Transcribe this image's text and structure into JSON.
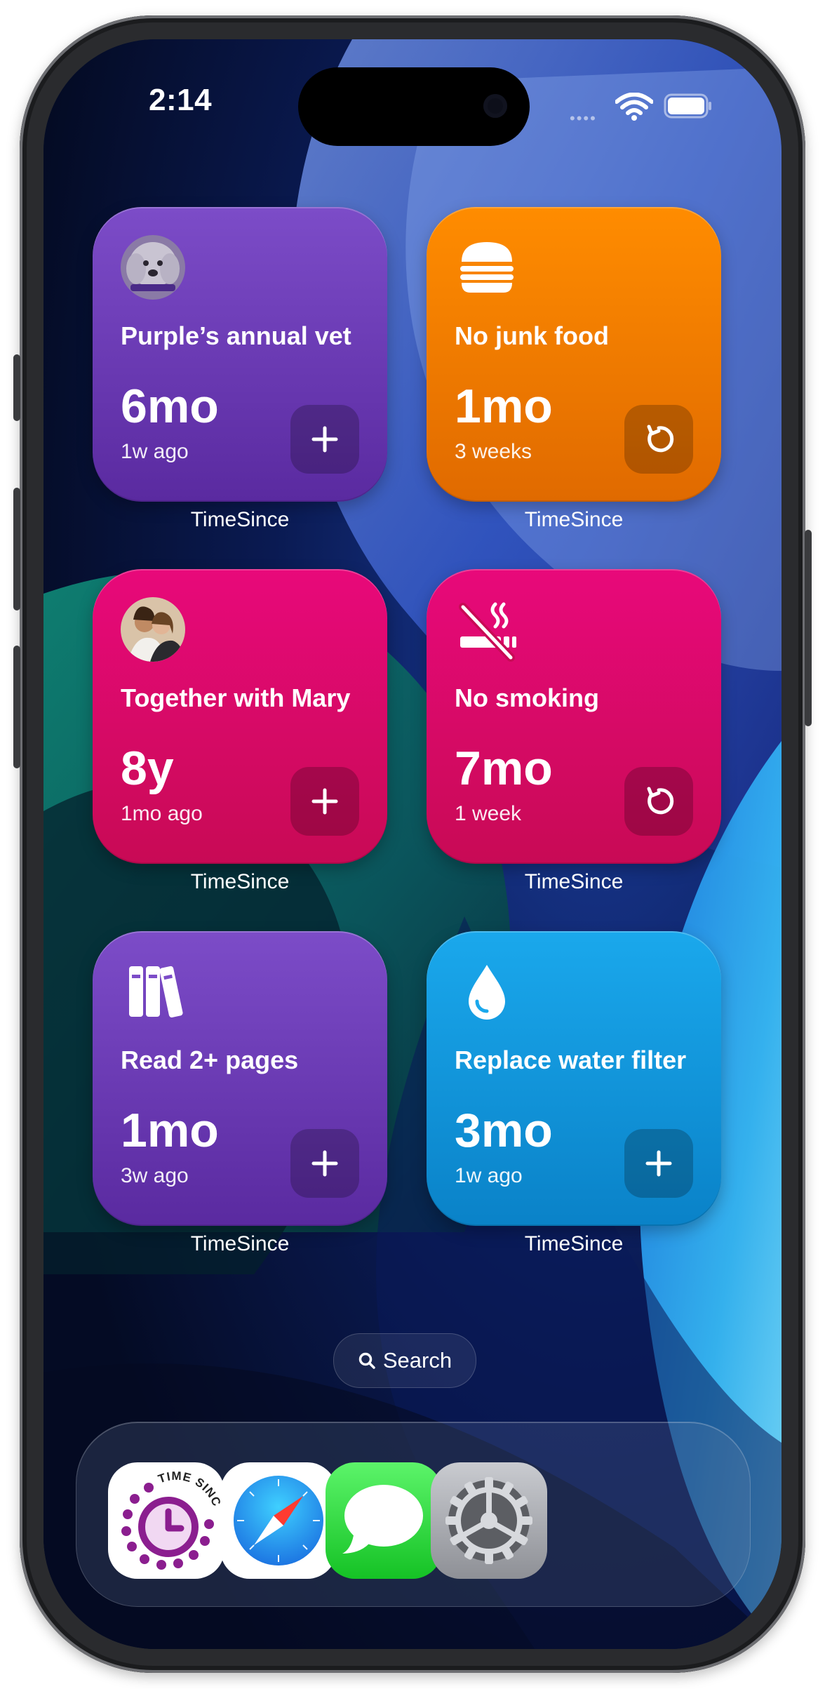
{
  "status_bar": {
    "time": "2:14"
  },
  "widgets": [
    {
      "title": "Purple’s annual vet",
      "value": "6mo",
      "subtitle": "1w ago",
      "app_label": "TimeSince",
      "action": "add",
      "color": "#6a3bb5"
    },
    {
      "title": "No junk food",
      "value": "1mo",
      "subtitle": "3 weeks",
      "app_label": "TimeSince",
      "action": "reset",
      "color": "#f07b00"
    },
    {
      "title": "Together with Mary",
      "value": "8y",
      "subtitle": "1mo ago",
      "app_label": "TimeSince",
      "action": "add",
      "color": "#dc0a66"
    },
    {
      "title": "No smoking",
      "value": "7mo",
      "subtitle": "1 week",
      "app_label": "TimeSince",
      "action": "reset",
      "color": "#dc0a66"
    },
    {
      "title": "Read 2+ pages",
      "value": "1mo",
      "subtitle": "3w ago",
      "app_label": "TimeSince",
      "action": "add",
      "color": "#6a3bb5"
    },
    {
      "title": "Replace water filter",
      "value": "3mo",
      "subtitle": "1w ago",
      "app_label": "TimeSince",
      "action": "add",
      "color": "#0d95d8"
    }
  ],
  "search": {
    "label": "Search"
  },
  "dock": [
    {
      "name": "TimeSince",
      "logo_text": "TIME SINCE",
      "icon": "timesince-clock-icon"
    },
    {
      "name": "Safari",
      "icon": "compass-icon"
    },
    {
      "name": "Messages",
      "icon": "speech-bubble-icon"
    },
    {
      "name": "Settings",
      "icon": "gear-icon"
    }
  ]
}
